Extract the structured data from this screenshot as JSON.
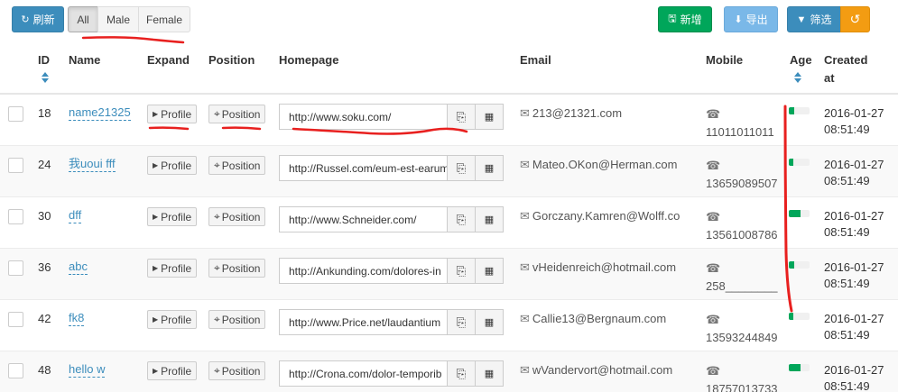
{
  "toolbar": {
    "refresh_label": "刷新",
    "segments": [
      "All",
      "Male",
      "Female"
    ],
    "add_label": "新增",
    "export_label": "导出",
    "filter_label": "筛选"
  },
  "columns": [
    "ID",
    "Name",
    "Expand",
    "Position",
    "Homepage",
    "Email",
    "Mobile",
    "Age",
    "Created at"
  ],
  "created_header": {
    "line1": "Created",
    "line2": "at"
  },
  "rows": [
    {
      "id": "18",
      "name": "name21325",
      "expand": "Profile",
      "position": "Position",
      "homepage": "http://www.soku.com/",
      "email": "213@21321.com",
      "mobile": "11011011011",
      "age": 0.25,
      "date": "2016-01-27",
      "time": "08:51:49"
    },
    {
      "id": "24",
      "name": "我uoui fff",
      "expand": "Profile",
      "position": "Position",
      "homepage": "http://Russel.com/eum-est-earum",
      "email": "Mateo.OKon@Herman.com",
      "mobile": "13659089507",
      "age": 0.2,
      "date": "2016-01-27",
      "time": "08:51:49"
    },
    {
      "id": "30",
      "name": "dff",
      "expand": "Profile",
      "position": "Position",
      "homepage": "http://www.Schneider.com/",
      "email": "Gorczany.Kamren@Wolff.co",
      "mobile": "13561008786",
      "age": 0.55,
      "date": "2016-01-27",
      "time": "08:51:49"
    },
    {
      "id": "36",
      "name": "abc",
      "expand": "Profile",
      "position": "Position",
      "homepage": "http://Ankunding.com/dolores-in",
      "email": "vHeidenreich@hotmail.com",
      "mobile": "258________",
      "age": 0.25,
      "date": "2016-01-27",
      "time": "08:51:49"
    },
    {
      "id": "42",
      "name": "fk8",
      "expand": "Profile",
      "position": "Position",
      "homepage": "http://www.Price.net/laudantium",
      "email": "Callie13@Bergnaum.com",
      "mobile": "13593244849",
      "age": 0.2,
      "date": "2016-01-27",
      "time": "08:51:49"
    },
    {
      "id": "48",
      "name": "hello w",
      "expand": "Profile",
      "position": "Position",
      "homepage": "http://Crona.com/dolor-temporib",
      "email": "wVandervort@hotmail.com",
      "mobile": "18757013733",
      "age": 0.55,
      "date": "2016-01-27",
      "time": "08:51:49"
    }
  ],
  "colors": {
    "primary": "#3c8dbc",
    "success": "#00a65a",
    "info": "#7ab8e8",
    "warning": "#f39c12",
    "annotation": "#e8201f"
  }
}
